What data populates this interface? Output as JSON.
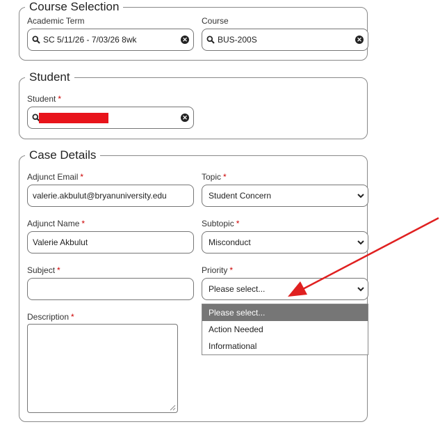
{
  "course_selection": {
    "legend": "Course Selection",
    "academic_term": {
      "label": "Academic Term",
      "value": "SC 5/11/26 - 7/03/26 8wk"
    },
    "course": {
      "label": "Course",
      "value": "BUS-200S"
    }
  },
  "student_section": {
    "legend": "Student",
    "student": {
      "label": "Student",
      "required": "*",
      "value": ""
    }
  },
  "case_details": {
    "legend": "Case Details",
    "adjunct_email": {
      "label": "Adjunct Email",
      "required": "*",
      "value": "valerie.akbulut@bryanuniversity.edu"
    },
    "topic": {
      "label": "Topic",
      "required": "*",
      "value": "Student Concern"
    },
    "adjunct_name": {
      "label": "Adjunct Name",
      "required": "*",
      "value": "Valerie Akbulut"
    },
    "subtopic": {
      "label": "Subtopic",
      "required": "*",
      "value": "Misconduct"
    },
    "subject": {
      "label": "Subject",
      "required": "*",
      "value": ""
    },
    "priority": {
      "label": "Priority",
      "required": "*",
      "value": "Please select...",
      "options": [
        "Please select...",
        "Action Needed",
        "Informational"
      ],
      "highlighted_index": 0
    },
    "description": {
      "label": "Description",
      "required": "*",
      "value": ""
    }
  },
  "colors": {
    "required": "#cc0000",
    "annotation_arrow": "#e02020",
    "redaction": "#e8141b"
  },
  "icons": {
    "search": "search-icon",
    "clear": "clear-icon",
    "chevron": "chevron-down-icon"
  }
}
